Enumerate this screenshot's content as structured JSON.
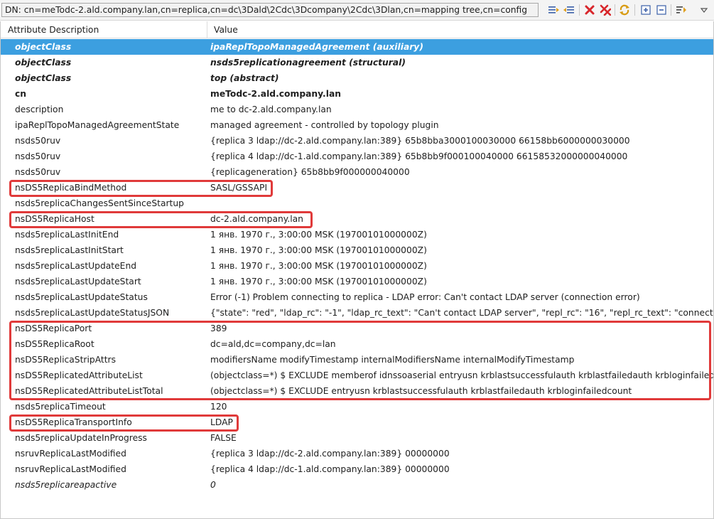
{
  "toolbar": {
    "dn": "DN: cn=meTodc-2.ald.company.lan,cn=replica,cn=dc\\3Dald\\2Cdc\\3Dcompany\\2Cdc\\3Dlan,cn=mapping tree,cn=config",
    "icons": [
      "expand-all-icon",
      "collapse-all-icon",
      "delete-value-icon",
      "delete-all-icon",
      "refresh-icon",
      "expand-icon",
      "collapse-icon",
      "sort-icon",
      "view-menu-icon"
    ]
  },
  "columns": {
    "attribute": "Attribute Description",
    "value": "Value"
  },
  "rows": [
    {
      "attr": "objectClass",
      "value": "ipaReplTopoManagedAgreement (auxiliary)",
      "style": "bold-italic",
      "selected": true
    },
    {
      "attr": "objectClass",
      "value": "nsds5replicationagreement (structural)",
      "style": "bold-italic"
    },
    {
      "attr": "objectClass",
      "value": "top (abstract)",
      "style": "bold-italic"
    },
    {
      "attr": "cn",
      "value": "meTodc-2.ald.company.lan",
      "style": "bold"
    },
    {
      "attr": "description",
      "value": "me to dc-2.ald.company.lan"
    },
    {
      "attr": "ipaReplTopoManagedAgreementState",
      "value": "managed agreement - controlled by topology plugin"
    },
    {
      "attr": "nsds50ruv",
      "value": "{replica 3 ldap://dc-2.ald.company.lan:389} 65b8bba3000100030000 66158bb6000000030000"
    },
    {
      "attr": "nsds50ruv",
      "value": "{replica 4 ldap://dc-1.ald.company.lan:389} 65b8bb9f000100040000 66158532000000040000"
    },
    {
      "attr": "nsds50ruv",
      "value": "{replicageneration} 65b8bb9f000000040000"
    },
    {
      "attr": "nsDS5ReplicaBindMethod",
      "value": "SASL/GSSAPI"
    },
    {
      "attr": "nsds5replicaChangesSentSinceStartup",
      "value": ""
    },
    {
      "attr": "nsDS5ReplicaHost",
      "value": "dc-2.ald.company.lan"
    },
    {
      "attr": "nsds5replicaLastInitEnd",
      "value": "1 янв. 1970 г., 3:00:00 MSK (19700101000000Z)"
    },
    {
      "attr": "nsds5replicaLastInitStart",
      "value": "1 янв. 1970 г., 3:00:00 MSK (19700101000000Z)"
    },
    {
      "attr": "nsds5replicaLastUpdateEnd",
      "value": "1 янв. 1970 г., 3:00:00 MSK (19700101000000Z)"
    },
    {
      "attr": "nsds5replicaLastUpdateStart",
      "value": "1 янв. 1970 г., 3:00:00 MSK (19700101000000Z)"
    },
    {
      "attr": "nsds5replicaLastUpdateStatus",
      "value": "Error (-1) Problem connecting to replica - LDAP error: Can't contact LDAP server (connection error)"
    },
    {
      "attr": "nsds5replicaLastUpdateStatusJSON",
      "value": "{\"state\": \"red\", \"ldap_rc\": \"-1\", \"ldap_rc_text\": \"Can't contact LDAP server\", \"repl_rc\": \"16\", \"repl_rc_text\": \"connection"
    },
    {
      "attr": "nsDS5ReplicaPort",
      "value": "389"
    },
    {
      "attr": "nsDS5ReplicaRoot",
      "value": "dc=ald,dc=company,dc=lan"
    },
    {
      "attr": "nsDS5ReplicaStripAttrs",
      "value": "modifiersName modifyTimestamp internalModifiersName internalModifyTimestamp"
    },
    {
      "attr": "nsDS5ReplicatedAttributeList",
      "value": "(objectclass=*) $ EXCLUDE memberof idnssoaserial entryusn krblastsuccessfulauth krblastfailedauth krbloginfailedcou"
    },
    {
      "attr": "nsDS5ReplicatedAttributeListTotal",
      "value": "(objectclass=*) $ EXCLUDE entryusn krblastsuccessfulauth krblastfailedauth krbloginfailedcount"
    },
    {
      "attr": "nsds5replicaTimeout",
      "value": "120"
    },
    {
      "attr": "nsDS5ReplicaTransportInfo",
      "value": "LDAP"
    },
    {
      "attr": "nsds5replicaUpdateInProgress",
      "value": "FALSE"
    },
    {
      "attr": "nsruvReplicaLastModified",
      "value": "{replica 3 ldap://dc-2.ald.company.lan:389} 00000000"
    },
    {
      "attr": "nsruvReplicaLastModified",
      "value": "{replica 4 ldap://dc-1.ald.company.lan:389} 00000000"
    },
    {
      "attr": "nsds5replicareapactive",
      "value": "0",
      "style": "italic"
    }
  ],
  "colors": {
    "selection": "#3c9fe0",
    "highlight": "#e03a3a"
  }
}
